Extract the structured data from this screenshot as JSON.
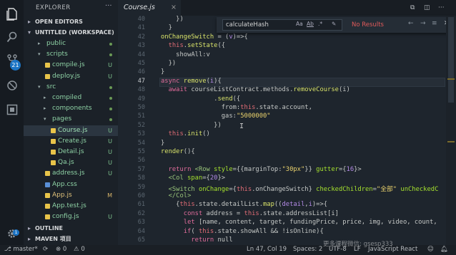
{
  "tab": {
    "title": "Course.js",
    "close": "×"
  },
  "sidebar": {
    "title": "EXPLORER",
    "open_editors": "OPEN EDITORS",
    "workspace": "UNTITLED (WORKSPACE)",
    "outline": "OUTLINE",
    "maven": "MAVEN 项目",
    "tree": [
      {
        "label": "public",
        "kind": "folder",
        "open": false,
        "depth": 1,
        "status": "dot"
      },
      {
        "label": "scripts",
        "kind": "folder",
        "open": true,
        "depth": 1,
        "status": "dot"
      },
      {
        "label": "compile.js",
        "kind": "js",
        "depth": 2,
        "status": "U"
      },
      {
        "label": "deploy.js",
        "kind": "js",
        "depth": 2,
        "status": "U"
      },
      {
        "label": "src",
        "kind": "folder",
        "open": true,
        "depth": 1,
        "status": "dot"
      },
      {
        "label": "compiled",
        "kind": "folder",
        "open": false,
        "depth": 2,
        "status": "dot"
      },
      {
        "label": "components",
        "kind": "folder",
        "open": false,
        "depth": 2,
        "status": "dot"
      },
      {
        "label": "pages",
        "kind": "folder",
        "open": true,
        "depth": 2,
        "status": "dot"
      },
      {
        "label": "Course.js",
        "kind": "js",
        "depth": 3,
        "status": "U",
        "selected": true
      },
      {
        "label": "Create.js",
        "kind": "js",
        "depth": 3,
        "status": "U"
      },
      {
        "label": "Detail.js",
        "kind": "js",
        "depth": 3,
        "status": "U"
      },
      {
        "label": "Qa.js",
        "kind": "js",
        "depth": 3,
        "status": "U"
      },
      {
        "label": "address.js",
        "kind": "js",
        "depth": 2,
        "status": "U"
      },
      {
        "label": "App.css",
        "kind": "css",
        "depth": 2,
        "status": ""
      },
      {
        "label": "App.js",
        "kind": "js",
        "depth": 2,
        "status": "M"
      },
      {
        "label": "App.test.js",
        "kind": "js",
        "depth": 2,
        "status": ""
      },
      {
        "label": "config.js",
        "kind": "js",
        "depth": 2,
        "status": "U"
      }
    ]
  },
  "activity": {
    "scm_badge": "21"
  },
  "find": {
    "query": "calculateHash",
    "opt_case": "Aa",
    "opt_word": "Ab",
    "opt_regex": ".*",
    "result": "No Results"
  },
  "lines": [
    {
      "num": "40",
      "html": "    })"
    },
    {
      "num": "41",
      "html": "  }"
    },
    {
      "num": "42",
      "html": "<span class='fn'>onChangeSwitch</span> = (<span class='ob'>v</span>)=>{"
    },
    {
      "num": "43",
      "html": "  <span class='this'>this</span>.<span class='fn'>setState</span>({"
    },
    {
      "num": "44",
      "html": "    showAll:v"
    },
    {
      "num": "45",
      "html": "  })"
    },
    {
      "num": "46",
      "html": "}"
    },
    {
      "num": "47",
      "html": "<span class='kw'>async</span> <span class='fn'>remove</span>(<span class='ob'>i</span>){"
    },
    {
      "num": "48",
      "html": "  <span class='kw'>await</span> courseListContract.methods.<span class='fn'>removeCourse</span>(i)"
    },
    {
      "num": "49",
      "html": "              .<span class='fn'>send</span>({"
    },
    {
      "num": "50",
      "html": "                from:<span class='this'>this</span>.state.account,"
    },
    {
      "num": "51",
      "html": "                gas:<span class='str'>\"5000000\"</span>"
    },
    {
      "num": "52",
      "html": "              })"
    },
    {
      "num": "53",
      "html": "  <span class='this'>this</span>.<span class='fn'>init</span>()"
    },
    {
      "num": "54",
      "html": "}"
    },
    {
      "num": "55",
      "html": "<span class='fn'>render</span>(){"
    },
    {
      "num": "56",
      "html": ""
    },
    {
      "num": "57",
      "html": "  <span class='kw'>return</span> <span class='tag'>&lt;Row</span> <span class='att'>style</span>={{marginTop:<span class='str'>\"30px\"</span>}} <span class='att'>gutter</span>={<span class='ob'>16</span>}&gt;"
    },
    {
      "num": "58",
      "html": "  <span class='tag'>&lt;Col</span> <span class='att'>span</span>={<span class='ob'>20</span>}&gt;"
    },
    {
      "num": "59",
      "html": "  <span class='tag'>&lt;Switch</span> <span class='att'>onChange</span>={<span class='this'>this</span>.onChangeSwitch} <span class='att'>checkedChildren</span>=<span class='str'>\"全部\"</span> <span class='att'>unCheckedC</span>"
    },
    {
      "num": "60",
      "html": "  <span class='tag'>&lt;/Col&gt;</span>"
    },
    {
      "num": "61",
      "html": "    {<span class='this'>this</span>.state.detailList.<span class='fn'>map</span>((<span class='ob'>detail</span>,<span class='ob'>i</span>)=>{"
    },
    {
      "num": "62",
      "html": "      <span class='kw'>const</span> address = <span class='this'>this</span>.state.addressList[i]"
    },
    {
      "num": "63",
      "html": "      <span class='kw'>let</span> [name, content, target, fundingPrice, price, img, video, count,"
    },
    {
      "num": "64",
      "html": "      <span class='kw'>if</span>( <span class='this'>this</span>.state.showAll && !isOnline){"
    },
    {
      "num": "65",
      "html": "        <span class='kw'>return</span> null"
    }
  ],
  "status": {
    "branch": "master*",
    "sync": "⟳",
    "errors": "⊗ 0",
    "warnings": "⚠ 0",
    "position": "Ln 47, Col 19",
    "spaces": "Spaces: 2",
    "encoding": "UTF-8",
    "eol": "LF",
    "language": "JavaScript React",
    "watermark": "更多课程微信: gsesp333"
  }
}
